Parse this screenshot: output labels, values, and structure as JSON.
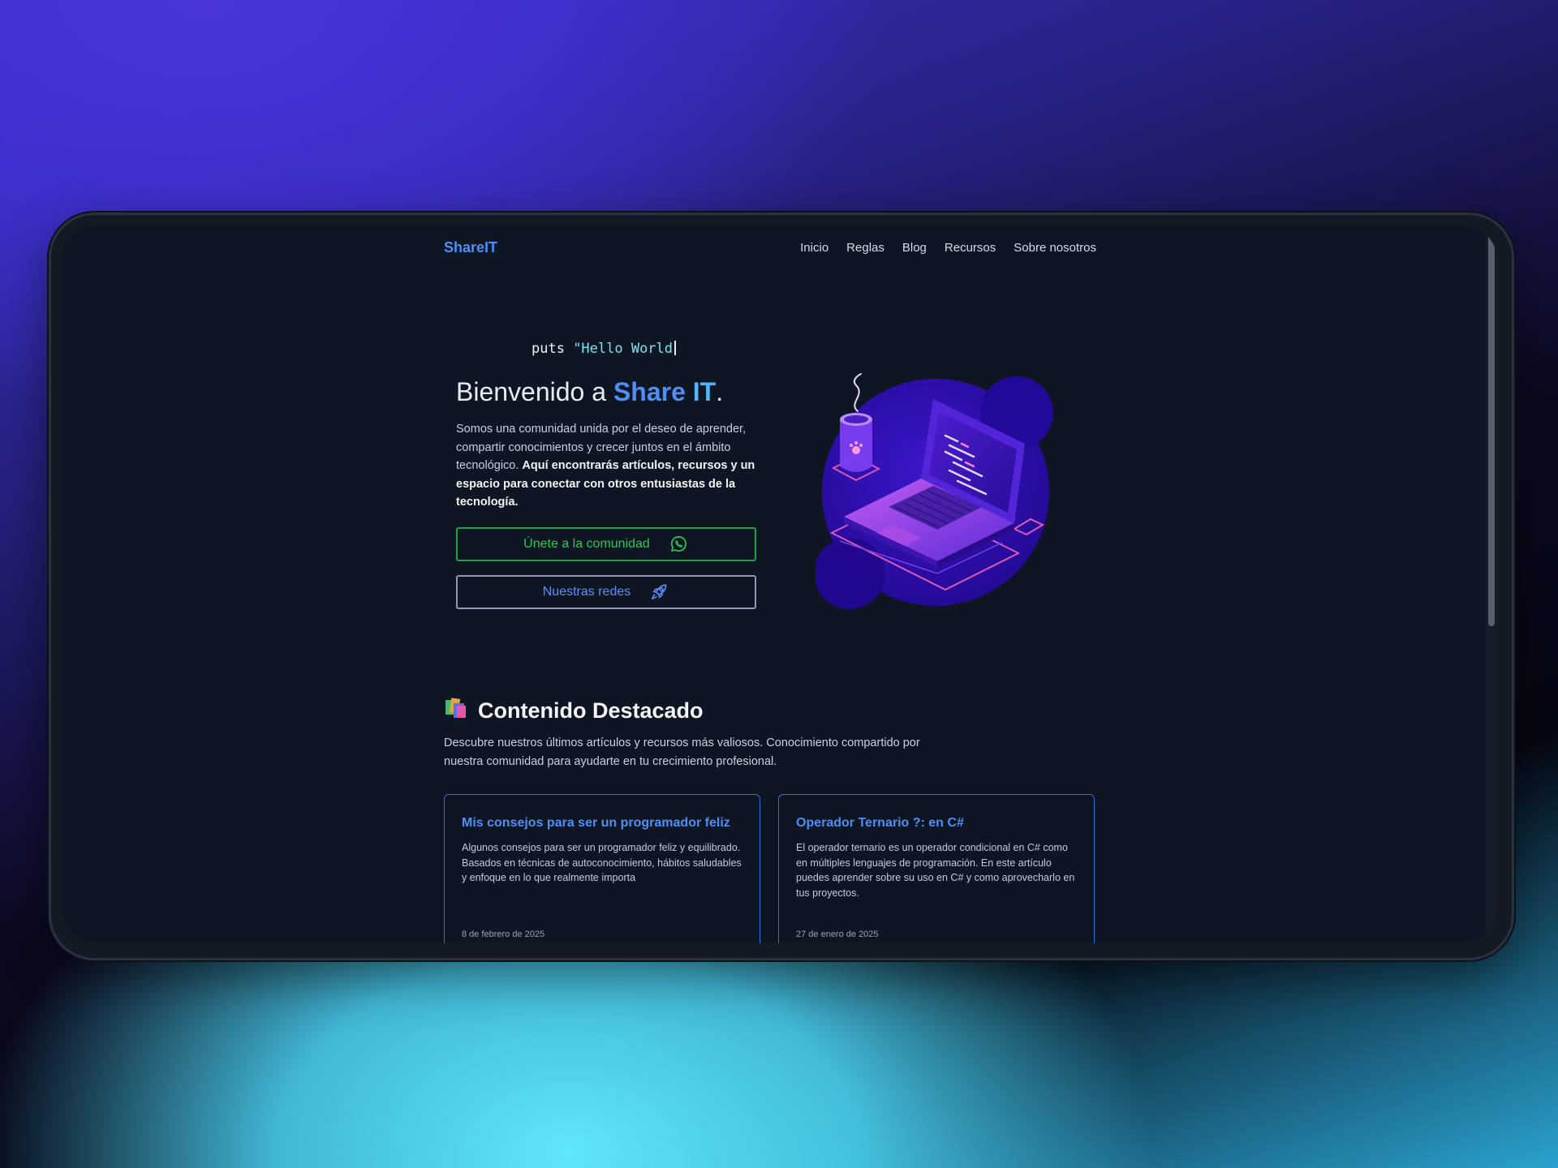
{
  "nav": {
    "logo": "ShareIT",
    "links": [
      "Inicio",
      "Reglas",
      "Blog",
      "Recursos",
      "Sobre nosotros"
    ]
  },
  "hero": {
    "terminal_cmd": "puts ",
    "terminal_str": "\"Hello World",
    "title_prefix": "Bienvenido a ",
    "title_brand_share": "Share",
    "title_brand_it": "IT",
    "title_suffix": ".",
    "description_plain": "Somos una comunidad unida por el deseo de aprender, compartir conocimientos y crecer juntos en el ámbito tecnológico.",
    "description_bold": "Aquí encontrarás artículos, recursos y un espacio para conectar con otros entusiastas de la tecnología.",
    "join_button": "Únete a la comunidad",
    "join_icon": "whatsapp-icon",
    "social_button": "Nuestras redes",
    "social_icon": "rocket-icon",
    "illustration": "isometric-laptop-illustration"
  },
  "featured": {
    "title": "Contenido Destacado",
    "title_icon": "books-icon",
    "description": "Descubre nuestros últimos artículos y recursos más valiosos. Conocimiento compartido por nuestra comunidad para ayudarte en tu crecimiento profesional.",
    "cards": [
      {
        "title": "Mis consejos para ser un programador feliz",
        "description": "Algunos consejos para ser un programador feliz y equilibrado. Basados en técnicas de autoconocimiento, hábitos saludables y enfoque en lo que realmente importa",
        "date": "8 de febrero de 2025"
      },
      {
        "title": "Operador Ternario ?: en C#",
        "description": "El operador ternario es un operador condicional en C# como en múltiples lenguajes de programación. En este artículo puedes aprender sobre su uso en C# y como aprovecharlo en tus proyectos.",
        "date": "27 de enero de 2025"
      }
    ]
  },
  "colors": {
    "page_bg": "#0f1623",
    "accent_blue": "#4d8ef7",
    "accent_green": "#2cc45a",
    "card_border": "#2f6fd9"
  }
}
